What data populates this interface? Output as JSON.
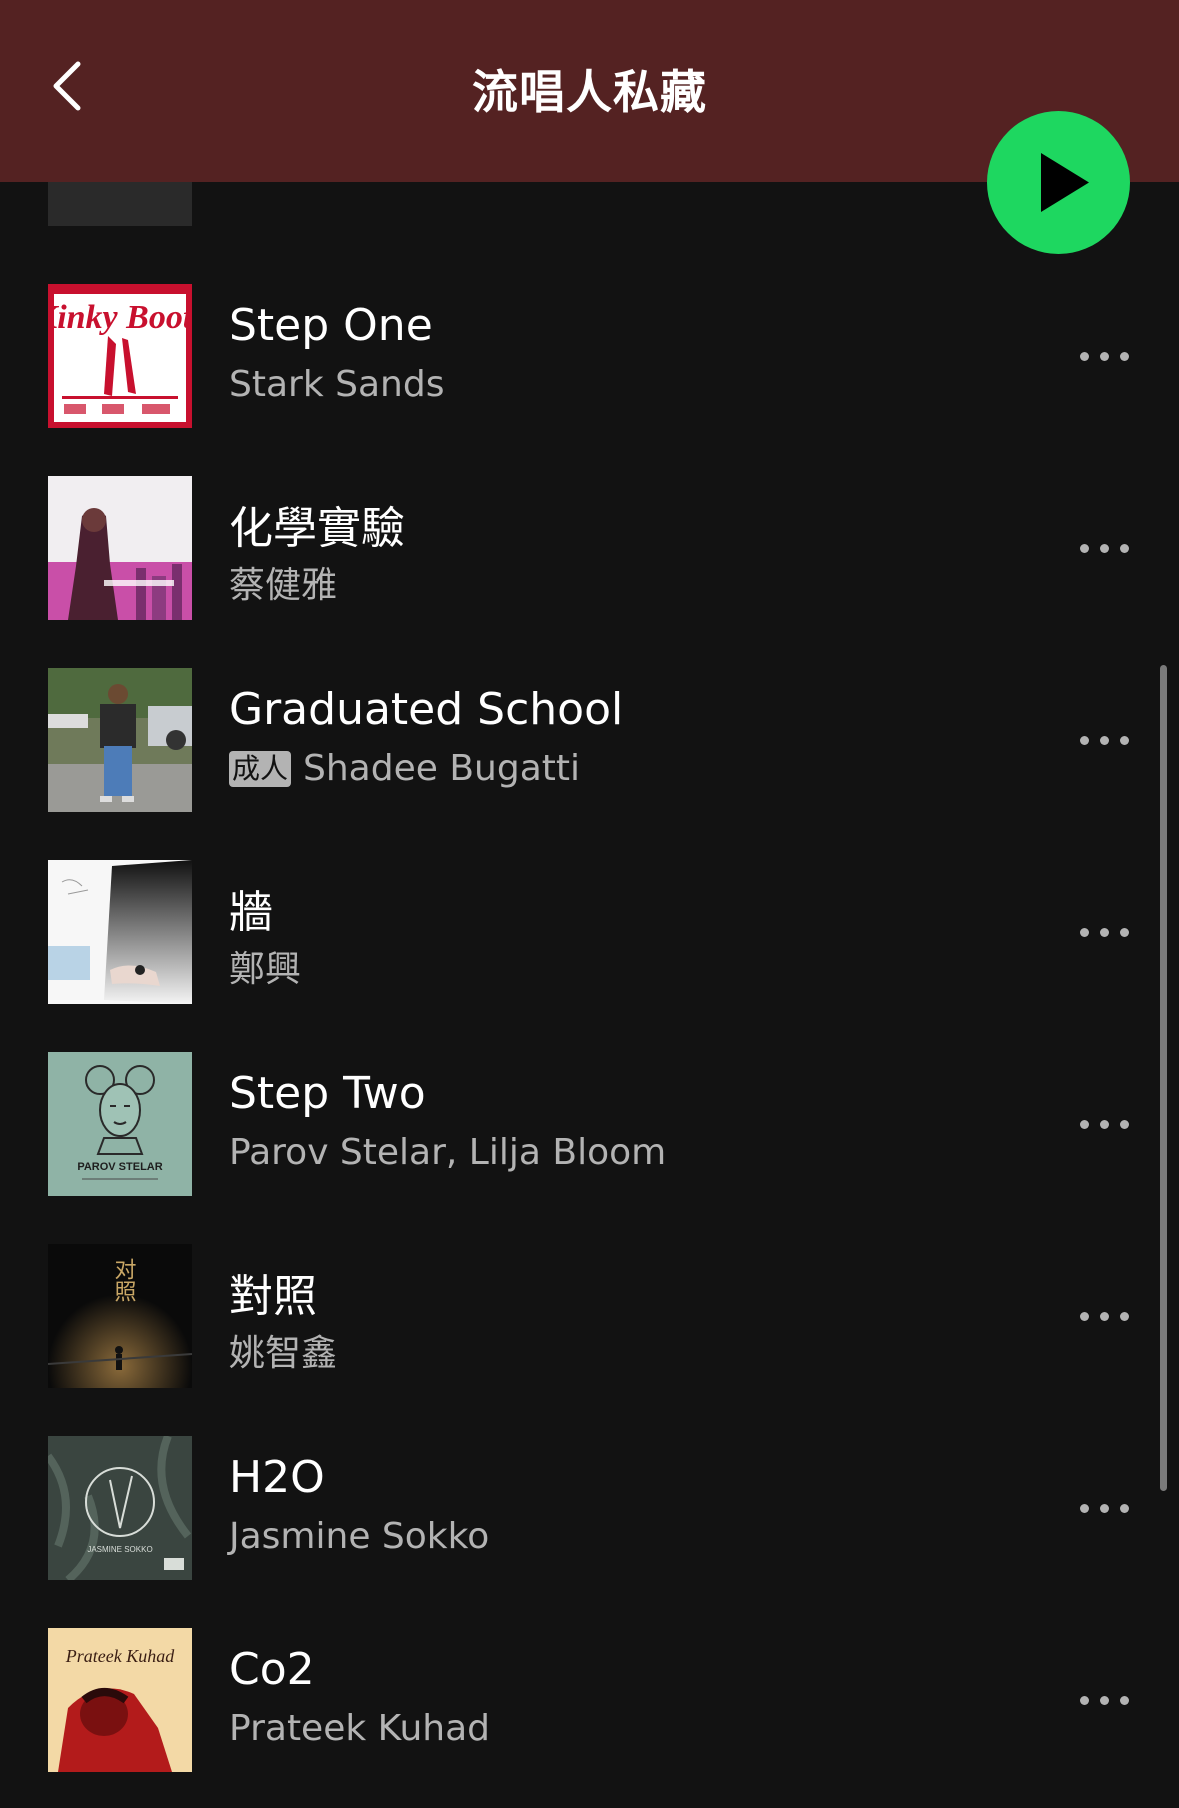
{
  "header": {
    "title": "流唱人私藏",
    "background": "#542222"
  },
  "accent": "#1ed760",
  "tracks": [
    {
      "title": "Step One",
      "artist": "Stark Sands",
      "explicit": false,
      "art_icon": "kinky-boots-cover"
    },
    {
      "title": "化學實驗",
      "artist": "蔡健雅",
      "explicit": false,
      "art_icon": "goodbye-hello-cover"
    },
    {
      "title": "Graduated School",
      "artist": "Shadee Bugatti",
      "explicit": true,
      "explicit_label": "成人",
      "art_icon": "street-photo-cover"
    },
    {
      "title": "牆",
      "artist": "鄭興",
      "explicit": false,
      "art_icon": "hand-sketch-cover"
    },
    {
      "title": "Step Two",
      "artist": "Parov Stelar, Lilja Bloom",
      "explicit": false,
      "art_icon": "parov-stelar-cover"
    },
    {
      "title": "對照",
      "artist": "姚智鑫",
      "explicit": false,
      "art_icon": "dark-stage-cover"
    },
    {
      "title": "H2O",
      "artist": "Jasmine Sokko",
      "explicit": false,
      "art_icon": "jasmine-sokko-cover"
    },
    {
      "title": "Co2",
      "artist": "Prateek Kuhad",
      "explicit": false,
      "art_icon": "prateek-kuhad-cover"
    }
  ],
  "art_text": {
    "kinky_boots": "Kinky Boots",
    "parov": "PAROV STELAR",
    "duizhao": "对照",
    "jasmine": "JASMINE SOKKO",
    "prateek": "Prateek Kuhad"
  }
}
